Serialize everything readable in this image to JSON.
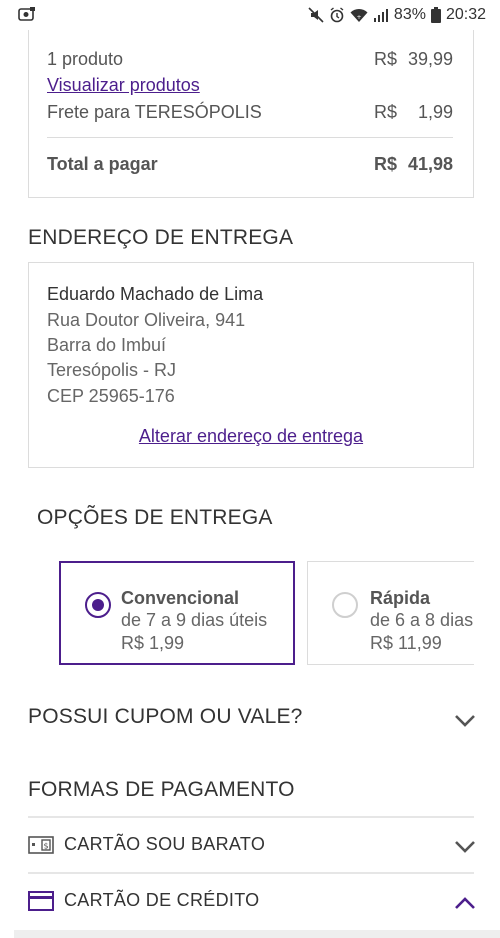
{
  "status_bar": {
    "battery": "83%",
    "time": "20:32",
    "icons": [
      "app-notification-icon",
      "mute-icon",
      "alarm-icon",
      "wifi-icon",
      "signal-icon",
      "battery-icon"
    ]
  },
  "summary": {
    "products_label": "1 produto",
    "products_currency": "R$",
    "products_value": "39,99",
    "view_products_link": "Visualizar produtos",
    "shipping_label": "Frete para TERESÓPOLIS",
    "shipping_currency": "R$",
    "shipping_value": "1,99",
    "total_label": "Total a pagar",
    "total_currency": "R$",
    "total_value": "41,98"
  },
  "address": {
    "title": "ENDEREÇO DE ENTREGA",
    "name": "Eduardo Machado de Lima",
    "street": "Rua Doutor Oliveira, 941",
    "district": "Barra do Imbuí",
    "city": "Teresópolis - RJ",
    "cep": "CEP 25965-176",
    "change_link": "Alterar endereço de entrega"
  },
  "delivery": {
    "title": "OPÇÕES DE ENTREGA",
    "options": [
      {
        "name": "Convencional",
        "time": "de 7 a 9 dias úteis",
        "price": "R$ 1,99",
        "selected": true
      },
      {
        "name": "Rápida",
        "time": "de 6 a 8 dias",
        "price": "R$ 11,99",
        "selected": false
      }
    ]
  },
  "coupon": {
    "title": "POSSUI CUPOM OU VALE?"
  },
  "payment": {
    "title": "FORMAS DE PAGAMENTO",
    "methods": [
      {
        "label": "CARTÃO SOU BARATO",
        "icon": "gift-card-icon",
        "expanded": false
      },
      {
        "label": "CARTÃO DE CRÉDITO",
        "icon": "credit-card-icon",
        "expanded": true
      }
    ]
  },
  "colors": {
    "accent": "#4c1e8c",
    "text": "#333333",
    "muted": "#666666",
    "border": "#dcdcdc"
  }
}
